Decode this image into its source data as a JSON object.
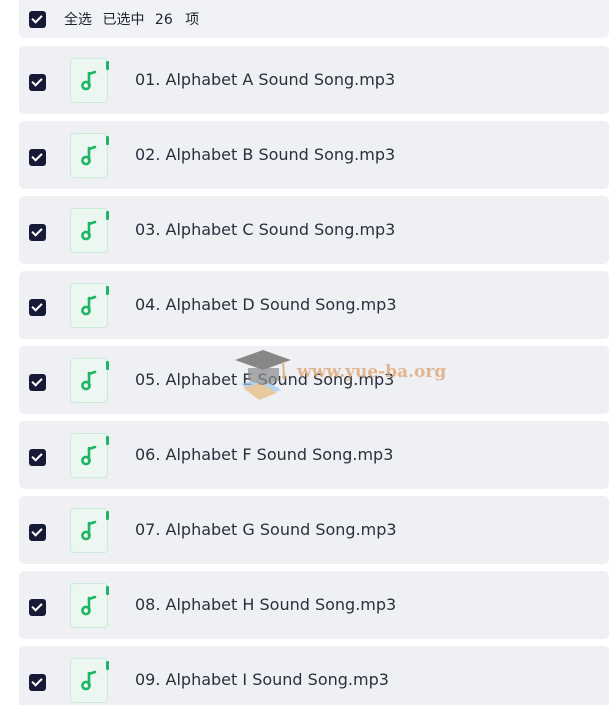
{
  "header": {
    "select_all_label": "全选",
    "selected_prefix": "已选中",
    "selected_count": "26",
    "selected_suffix": "项"
  },
  "files": [
    {
      "name": "01. Alphabet A Sound Song.mp3",
      "checked": true,
      "icon": "music-file-icon"
    },
    {
      "name": "02. Alphabet B Sound Song.mp3",
      "checked": true,
      "icon": "music-file-icon"
    },
    {
      "name": "03. Alphabet C Sound Song.mp3",
      "checked": true,
      "icon": "music-file-icon"
    },
    {
      "name": "04. Alphabet D Sound Song.mp3",
      "checked": true,
      "icon": "music-file-icon"
    },
    {
      "name": "05. Alphabet E Sound Song.mp3",
      "checked": true,
      "icon": "music-file-icon"
    },
    {
      "name": "06. Alphabet F Sound Song.mp3",
      "checked": true,
      "icon": "music-file-icon"
    },
    {
      "name": "07. Alphabet G Sound Song.mp3",
      "checked": true,
      "icon": "music-file-icon"
    },
    {
      "name": "08. Alphabet H Sound Song.mp3",
      "checked": true,
      "icon": "music-file-icon"
    },
    {
      "name": "09. Alphabet I Sound Song.mp3",
      "checked": true,
      "icon": "music-file-icon"
    }
  ],
  "watermark": {
    "text": "www.yue-ba.org",
    "icon": "graduation-cap-logo"
  },
  "colors": {
    "checkbox": "#171a36",
    "row_background": "#eef0f3",
    "music_icon": "#1fb565"
  }
}
